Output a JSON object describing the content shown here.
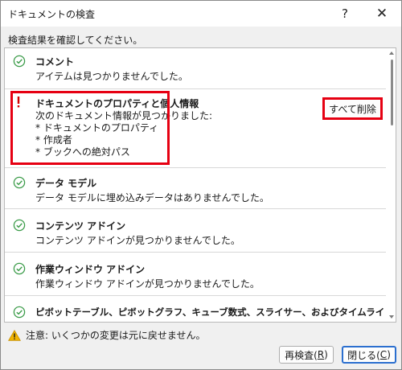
{
  "window": {
    "title": "ドキュメントの検査",
    "help_glyph": "?",
    "close_glyph": "✕"
  },
  "instruction": "検査結果を確認してください。",
  "results": {
    "comments": {
      "title": "コメント",
      "desc": "アイテムは見つかりませんでした。",
      "icon": "check-circle-icon"
    },
    "properties": {
      "title": "ドキュメントのプロパティと個人情報",
      "icon": "exclamation-icon",
      "details": [
        "次のドキュメント情報が見つかりました:",
        "* ドキュメントのプロパティ",
        "* 作成者",
        "* ブックへの絶対パス"
      ],
      "remove_all_label": "すべて削除"
    },
    "data_model": {
      "title": "データ モデル",
      "desc": "データ モデルに埋め込みデータはありませんでした。",
      "icon": "check-circle-icon"
    },
    "content_addins": {
      "title": "コンテンツ アドイン",
      "desc": "コンテンツ アドインが見つかりませんでした。",
      "icon": "check-circle-icon"
    },
    "taskpane_addins": {
      "title": "作業ウィンドウ アドイン",
      "desc": "作業ウィンドウ アドインが見つかりませんでした。",
      "icon": "check-circle-icon"
    },
    "pivot": {
      "title": "ピボットテーブル、ピボットグラフ、キューブ数式、スライサー、およびタイムライ",
      "icon": "check-circle-icon"
    }
  },
  "footer": {
    "warning": "注意: いくつかの変更は元に戻せません。",
    "reinspect_label": "再検査(",
    "reinspect_key": "R",
    "close_label": "閉じる(",
    "close_key": "C",
    "paren_close": ")"
  },
  "colors": {
    "check": "#3c9c4a",
    "alert": "#d40000",
    "highlight": "#e60012",
    "warning": "#f2b500"
  }
}
